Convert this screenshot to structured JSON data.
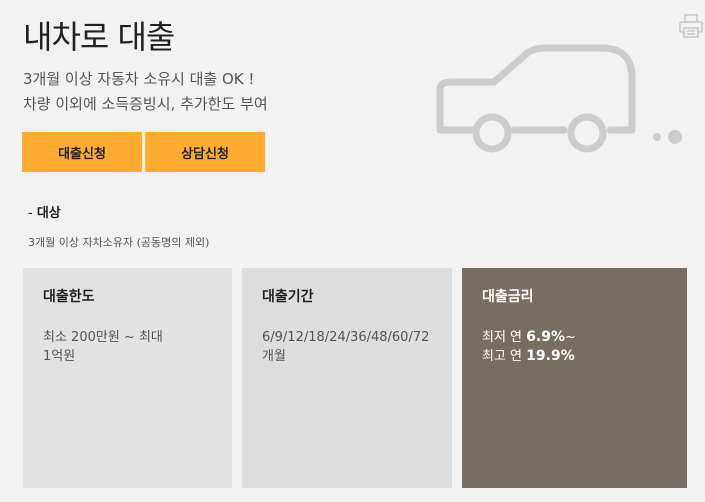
{
  "header": {
    "title": "내차로 대출"
  },
  "intro": {
    "line1": "3개월 이상 자동차 소유시 대출 OK !",
    "line2": "차량 이외에 소득증빙시, 추가한도 부여"
  },
  "buttons": {
    "apply": "대출신청",
    "consult": "상담신청"
  },
  "target": {
    "prefix": "- ",
    "heading": "대상",
    "text": "3개월 이상 자차소유자 (공동명의 제외)"
  },
  "cards": {
    "limit": {
      "title": "대출한도",
      "body_line1": "최소 200만원 ~ 최대",
      "body_line2": "1억원"
    },
    "term": {
      "title": "대출기간",
      "body_line1": "6/9/12/18/24/36/48/60/72",
      "body_line2": "개월"
    },
    "rate": {
      "title": "대출금리",
      "min_prefix": "최저 연 ",
      "min_value": "6.9%",
      "min_suffix": "~",
      "max_prefix": "최고 연 ",
      "max_value": "19.9%"
    }
  },
  "icons": {
    "print": "printer-icon",
    "car": "car-outline-illustration"
  },
  "colors": {
    "button_bg": "#ffac33",
    "rate_card_bg": "#786d62",
    "page_bg": "#f2f2f2"
  }
}
